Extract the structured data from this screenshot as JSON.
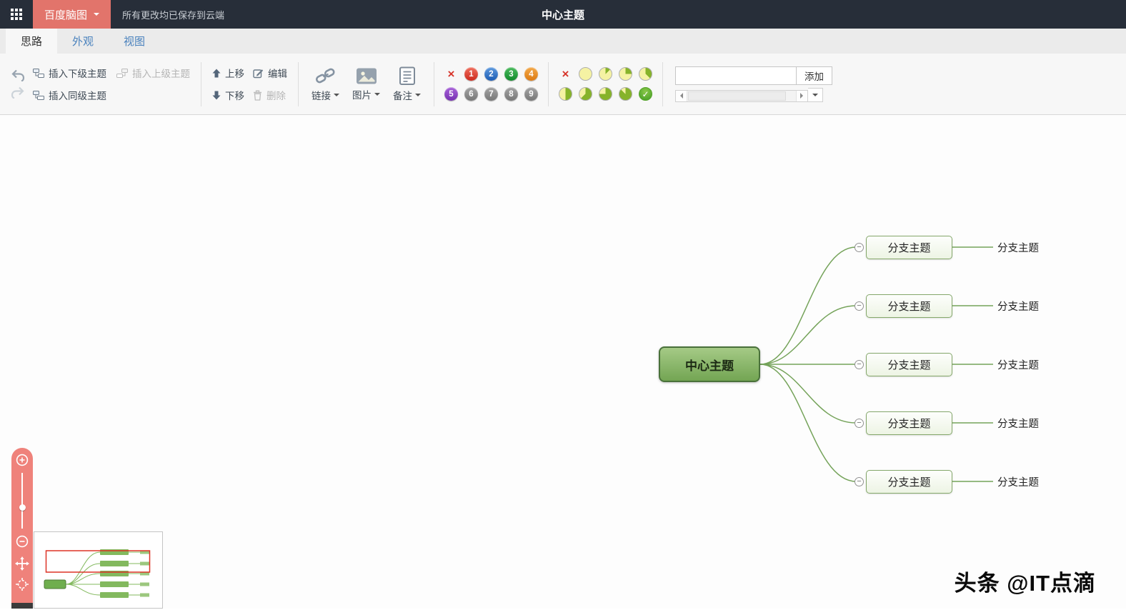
{
  "topbar": {
    "app_menu": "百度脑图",
    "save_status": "所有更改均已保存到云端",
    "title": "中心主题"
  },
  "tabs": {
    "idea": "思路",
    "appearance": "外观",
    "view": "视图"
  },
  "toolbar": {
    "insert_child": "插入下级主题",
    "insert_parent": "插入上级主题",
    "insert_sibling": "插入同级主题",
    "move_up": "上移",
    "move_down": "下移",
    "edit": "编辑",
    "delete": "删除",
    "link": "链接",
    "image": "图片",
    "note": "备注",
    "priority_numbers": [
      "1",
      "2",
      "3",
      "4",
      "5",
      "6",
      "7",
      "8",
      "9"
    ],
    "progress_levels": [
      "0/8",
      "1/8",
      "2/8",
      "3/8",
      "4/8",
      "5/8",
      "6/8",
      "7/8",
      "done"
    ],
    "tag": {
      "input_value": "",
      "add_button": "添加"
    }
  },
  "icons": {
    "remove": "×",
    "done_check": "✓",
    "collapse_minus": "−"
  },
  "mindmap": {
    "root": {
      "text": "中心主题",
      "selected": true
    },
    "branches": [
      {
        "text": "分支主题",
        "label": "分支主题"
      },
      {
        "text": "分支主题",
        "label": "分支主题"
      },
      {
        "text": "分支主题",
        "label": "分支主题"
      },
      {
        "text": "分支主题",
        "label": "分支主题"
      },
      {
        "text": "分支主题",
        "label": "分支主题"
      }
    ]
  },
  "watermark": "头条 @IT点滴",
  "colors": {
    "topbar_bg": "#272e39",
    "accent_salmon": "#e2746b",
    "zoom_panel": "#ef827b",
    "root_node_green": "#73a553",
    "branch_border_green": "#84a76a",
    "line_green": "#75a35a",
    "priority": [
      "#cd2a1d",
      "#1c5cb4",
      "#118a2c",
      "#dd7a12",
      "#7630b2",
      "#777777",
      "#777777",
      "#777777",
      "#777777"
    ],
    "progress_green": "#86b32a",
    "progress_yellow": "#f5f2a3",
    "viewport_red": "#dd3327",
    "tab_blue": "#4a82bd"
  }
}
